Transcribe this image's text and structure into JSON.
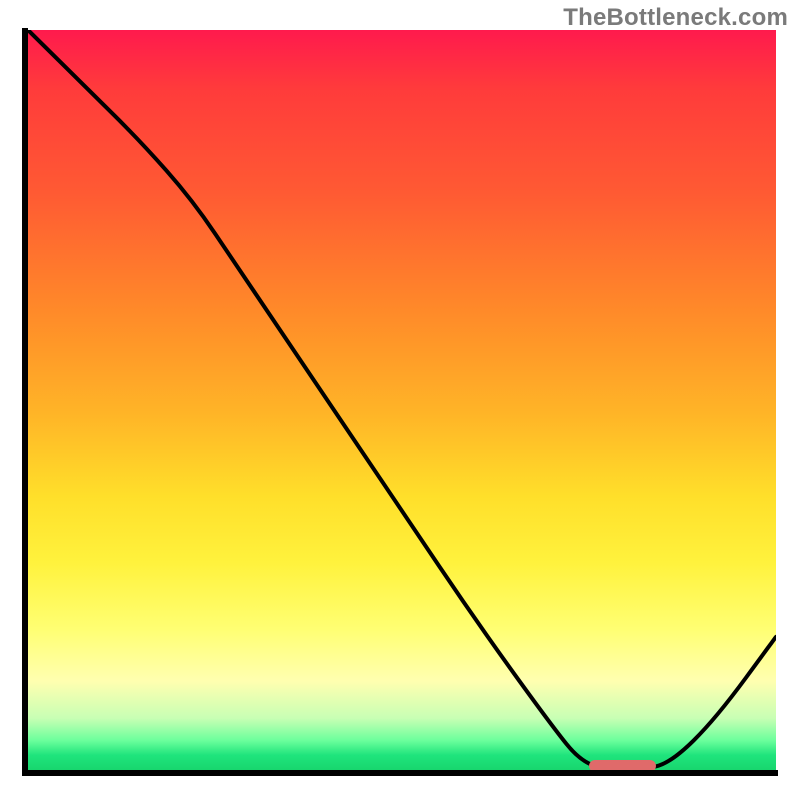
{
  "watermark": "TheBottleneck.com",
  "colors": {
    "axis": "#000000",
    "curve": "#000000",
    "marker": "#e06a6a",
    "gradient_top": "#ff1a4d",
    "gradient_bottom": "#18d66e"
  },
  "chart_data": {
    "type": "line",
    "title": "",
    "xlabel": "",
    "ylabel": "",
    "xlim": [
      0,
      100
    ],
    "ylim": [
      0,
      100
    ],
    "grid": false,
    "legend": false,
    "x": [
      0,
      8,
      15,
      22,
      28,
      40,
      50,
      60,
      70,
      74,
      78,
      82,
      86,
      92,
      100
    ],
    "values": [
      100,
      92,
      85,
      77,
      68,
      50,
      35,
      20,
      6,
      1,
      0,
      0,
      1,
      7,
      18
    ],
    "optimum_marker": {
      "x_start": 75,
      "x_end": 84,
      "y": 0
    },
    "annotations": []
  }
}
